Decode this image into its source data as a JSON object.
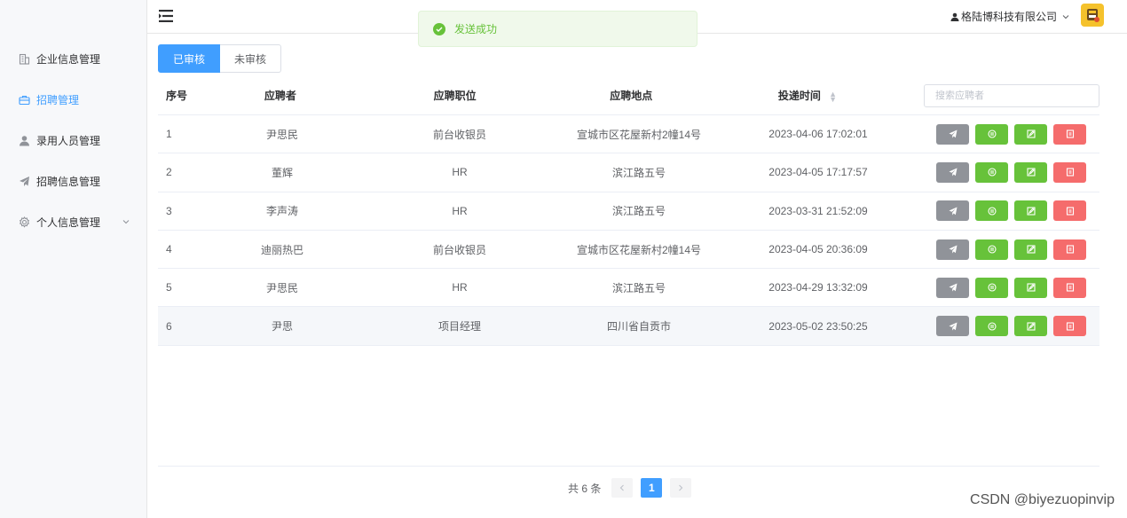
{
  "sidebar": {
    "items": [
      {
        "label": "企业信息管理",
        "icon": "building-icon"
      },
      {
        "label": "招聘管理",
        "icon": "briefcase-icon",
        "active": true
      },
      {
        "label": "录用人员管理",
        "icon": "user-icon"
      },
      {
        "label": "招聘信息管理",
        "icon": "paper-plane-icon"
      },
      {
        "label": "个人信息管理",
        "icon": "gear-icon"
      }
    ]
  },
  "header": {
    "company": "格陆博科技有限公司"
  },
  "toast": {
    "message": "发送成功"
  },
  "tabs": [
    "已审核",
    "未审核"
  ],
  "table": {
    "headers": {
      "index": "序号",
      "name": "应聘者",
      "position": "应聘职位",
      "location": "应聘地点",
      "time": "投递时间"
    },
    "search_placeholder": "搜索应聘者",
    "rows": [
      {
        "index": "1",
        "name": "尹思民",
        "position": "前台收银员",
        "location": "宣城市区花屋新村2幢14号",
        "time": "2023-04-06 17:02:01"
      },
      {
        "index": "2",
        "name": "董辉",
        "position": "HR",
        "location": "滨江路五号",
        "time": "2023-04-05 17:17:57"
      },
      {
        "index": "3",
        "name": "李声涛",
        "position": "HR",
        "location": "滨江路五号",
        "time": "2023-03-31 21:52:09"
      },
      {
        "index": "4",
        "name": "迪丽热巴",
        "position": "前台收银员",
        "location": "宣城市区花屋新村2幢14号",
        "time": "2023-04-05 20:36:09"
      },
      {
        "index": "5",
        "name": "尹思民",
        "position": "HR",
        "location": "滨江路五号",
        "time": "2023-04-29 13:32:09"
      },
      {
        "index": "6",
        "name": "尹思",
        "position": "项目经理",
        "location": "四川省自贡市",
        "time": "2023-05-02 23:50:25"
      }
    ]
  },
  "pagination": {
    "total_text": "共 6 条",
    "current_page": "1"
  },
  "watermark": "CSDN @biyezuopinvip",
  "colors": {
    "primary": "#409eff",
    "success": "#67c23a",
    "danger": "#f56c6c",
    "info": "#909399"
  }
}
